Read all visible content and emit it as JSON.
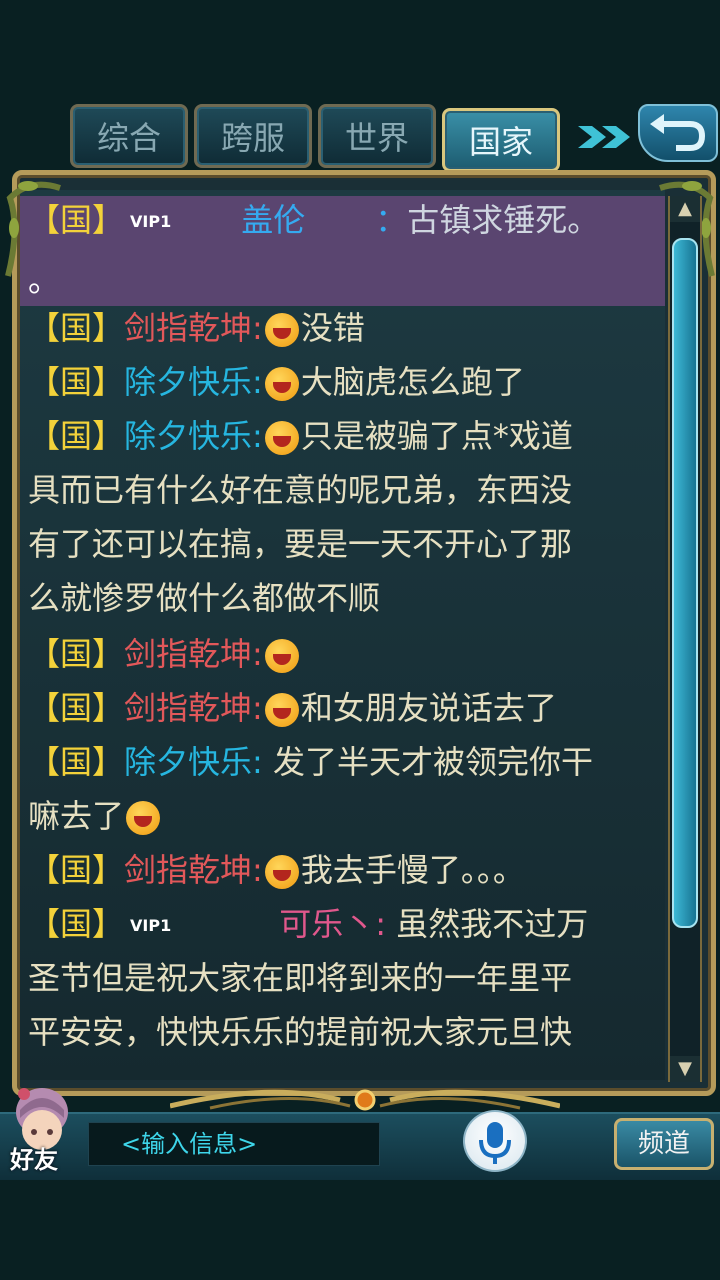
{
  "tabs": [
    {
      "label": "综合",
      "active": false
    },
    {
      "label": "跨服",
      "active": false
    },
    {
      "label": "世界",
      "active": false
    },
    {
      "label": "国家",
      "active": true
    }
  ],
  "chat": {
    "channel_tag": "【国】",
    "vip_label": "VIP1",
    "messages": [
      {
        "name": "盖伦",
        "sep": "：",
        "text_lines": [
          "古镇求锤死。",
          "。"
        ]
      },
      {
        "name": "剑指乾坤:",
        "text": "没错"
      },
      {
        "name": "除夕快乐:",
        "text": "大脑虎怎么跑了"
      },
      {
        "name": "除夕快乐:",
        "text_lines": [
          "只是被骗了点*戏道",
          "具而已有什么好在意的呢兄弟，东西没",
          "有了还可以在搞，要是一天不开心了那",
          "么就惨罗做什么都做不顺"
        ]
      },
      {
        "name": "剑指乾坤:",
        "text": ""
      },
      {
        "name": "剑指乾坤:",
        "text": "和女朋友说话去了"
      },
      {
        "name": "除夕快乐:",
        "text_lines": [
          " 发了半天才被领完你干",
          "嘛去了"
        ]
      },
      {
        "name": "剑指乾坤:",
        "text": "我去手慢了。。。"
      },
      {
        "name": "可乐丶:",
        "text_lines": [
          " 虽然我不过万",
          "圣节但是祝大家在即将到来的一年里平",
          "平安安，快快乐乐的提前祝大家元旦快"
        ]
      }
    ]
  },
  "scrollbar": {
    "up": "▲",
    "down": "▼"
  },
  "bottom": {
    "friend_label": "好友",
    "input_placeholder": "<输入信息>",
    "channel_button": "频道"
  },
  "colors": {
    "tag": "#f3d23a",
    "name_red": "#e2585a",
    "name_cyan": "#26b6e0",
    "name_pink": "#e0588c",
    "vip_bg": "#5a4570"
  }
}
